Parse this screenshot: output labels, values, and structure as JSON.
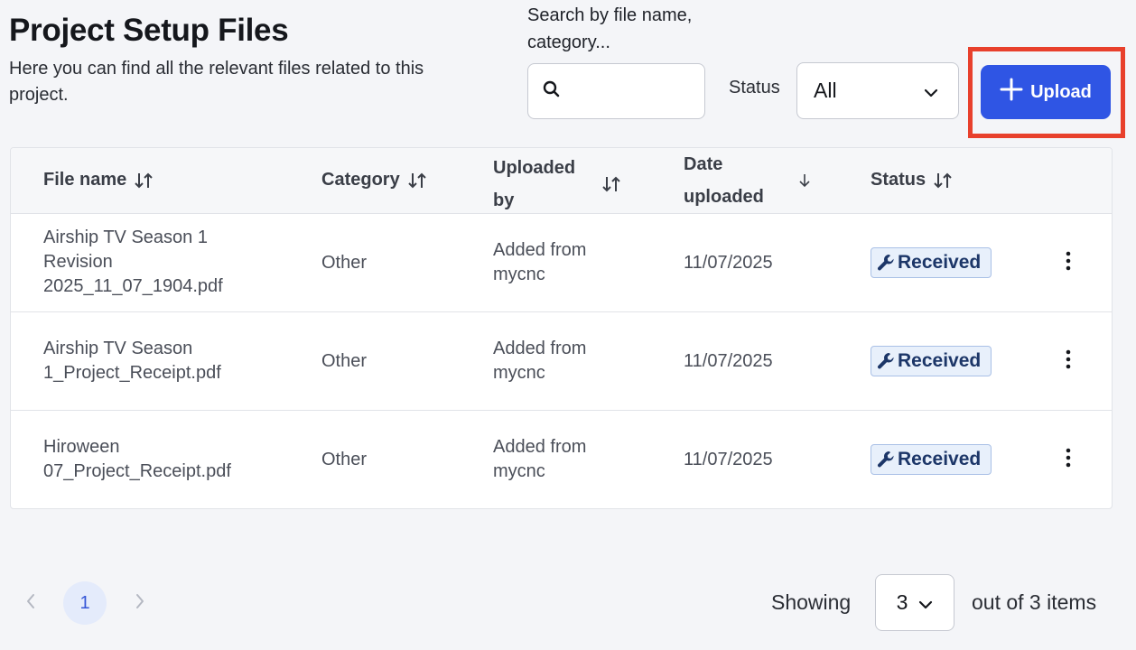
{
  "header": {
    "title": "Project Setup Files",
    "subtitle": "Here you can find all the relevant files related to this project."
  },
  "search": {
    "label": "Search by file name, category...",
    "value": "",
    "placeholder": ""
  },
  "status_filter": {
    "label": "Status",
    "selected": "All"
  },
  "upload_button": {
    "label": "Upload",
    "color": "#2f55e4",
    "highlight_color": "#e8402c"
  },
  "table": {
    "columns": [
      {
        "label": "File name",
        "sort": "both"
      },
      {
        "label": "Category",
        "sort": "both"
      },
      {
        "label": "Uploaded by",
        "sort": "both"
      },
      {
        "label": "Date uploaded",
        "sort": "descending"
      },
      {
        "label": "Status",
        "sort": "both"
      }
    ],
    "rows": [
      {
        "file_name": "Airship TV Season 1 Revision 2025_11_07_1904.pdf",
        "category": "Other",
        "uploaded_by": "Added from mycnc",
        "date": "11/07/2025",
        "status": "Received"
      },
      {
        "file_name": "Airship TV Season 1_Project_Receipt.pdf",
        "category": "Other",
        "uploaded_by": "Added from mycnc",
        "date": "11/07/2025",
        "status": "Received"
      },
      {
        "file_name": "Hiroween 07_Project_Receipt.pdf",
        "category": "Other",
        "uploaded_by": "Added from mycnc",
        "date": "11/07/2025",
        "status": "Received"
      }
    ]
  },
  "pagination": {
    "current_page": "1",
    "showing_label": "Showing",
    "page_size": "3",
    "items_label": "out of 3 items"
  }
}
